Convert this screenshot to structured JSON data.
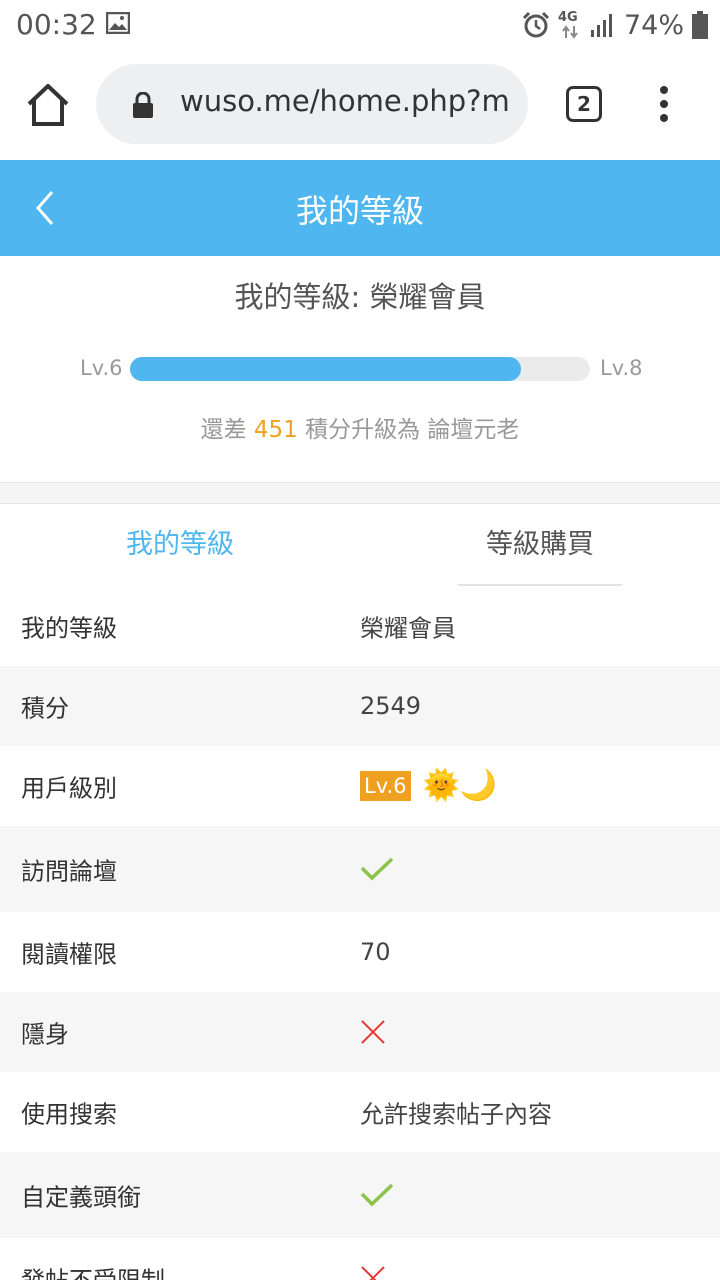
{
  "status_bar": {
    "time": "00:32",
    "network": "4G",
    "battery": "74%"
  },
  "browser": {
    "url": "wuso.me/home.php?m",
    "tab_count": "2"
  },
  "header": {
    "title": "我的等級"
  },
  "summary": {
    "level_title": "我的等級: 榮耀會員",
    "lv_from": "Lv.6",
    "lv_to": "Lv.8",
    "progress": 0.85,
    "need_prefix": "還差",
    "need_points": "451",
    "need_suffix": "積分升級為 論壇元老"
  },
  "tabs": [
    {
      "label": "我的等級",
      "active": true
    },
    {
      "label": "等級購買",
      "active": false
    }
  ],
  "rows": [
    {
      "label": "我的等級",
      "value": "榮耀會員"
    },
    {
      "label": "積分",
      "value": "2549"
    },
    {
      "label": "用戶級別",
      "badge": "Lv.6",
      "icons": "🌞🌙"
    },
    {
      "label": "訪問論壇",
      "check": "yes"
    },
    {
      "label": "閱讀權限",
      "value": "70"
    },
    {
      "label": "隱身",
      "check": "no"
    },
    {
      "label": "使用搜索",
      "value": "允許搜索帖子內容"
    },
    {
      "label": "自定義頭銜",
      "check": "yes"
    },
    {
      "label": "發帖不受限制",
      "check": "no"
    }
  ],
  "colors": {
    "accent": "#4fb6f0",
    "badge": "#f0a020",
    "check": "#8bc34a",
    "cross": "#e53935"
  }
}
